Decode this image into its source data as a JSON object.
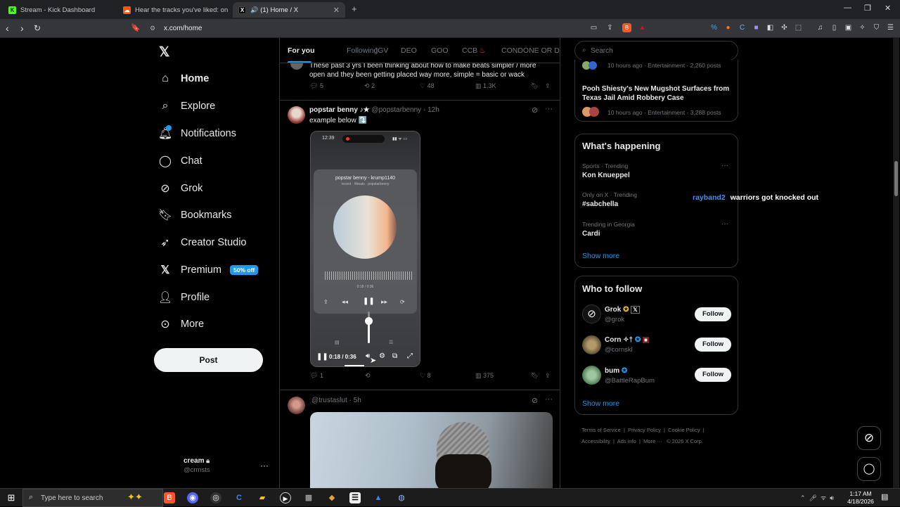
{
  "browser": {
    "tabs": [
      {
        "title": "Stream - Kick Dashboard",
        "icon": "kick-icon"
      },
      {
        "title": "Hear the tracks you've liked: on Sou",
        "icon": "soundcloud-icon"
      },
      {
        "title": "(1) Home / X",
        "icon": "x-icon"
      }
    ],
    "url": "x.com/home"
  },
  "nav": {
    "items": [
      {
        "label": "Home",
        "icon": "home-icon"
      },
      {
        "label": "Explore",
        "icon": "search-icon"
      },
      {
        "label": "Notifications",
        "icon": "bell-icon"
      },
      {
        "label": "Chat",
        "icon": "chat-icon"
      },
      {
        "label": "Grok",
        "icon": "grok-icon"
      },
      {
        "label": "Bookmarks",
        "icon": "bookmark-icon"
      },
      {
        "label": "Creator Studio",
        "icon": "rocket-icon"
      },
      {
        "label": "Premium",
        "icon": "x-logo-icon"
      },
      {
        "label": "Profile",
        "icon": "person-icon"
      },
      {
        "label": "More",
        "icon": "more-circle-icon"
      }
    ],
    "premium_badge": "50% off",
    "post_label": "Post",
    "account": {
      "name": "cream",
      "handle": "@crmsts"
    }
  },
  "feed": {
    "tabs": [
      "For you",
      "Following",
      "JGV",
      "DEO",
      "GOO",
      "CCB",
      "CONDONE OR DIE"
    ],
    "post1": {
      "text": "These past 3 yrs I been thinking about how to make beats simpler / more open and they been getting placed way more, simple = basic or wack",
      "replies": "5",
      "reposts": "2",
      "likes": "48",
      "views": "1.3K"
    },
    "post2": {
      "name": "popstar benny ♪★",
      "handle": "@popstarbenny",
      "time": "12h",
      "text": "example below ⤵️",
      "replies": "1",
      "reposts": "",
      "likes": "8",
      "views": "375",
      "video": {
        "time": "0:18 / 0:36",
        "phone_clock": "12:39",
        "track_title": "popstar benny - krump1140",
        "track_sub": "recent · #beats · popstarbenny",
        "track_time": "0:18 / 0:36",
        "volume": 0.72
      }
    },
    "post3": {
      "handle": "@trustaslut",
      "time": "5h"
    }
  },
  "right": {
    "search_placeholder": "Search",
    "top_trends": [
      {
        "meta": "10 hours ago · Entertainment · 2,260 posts"
      },
      {
        "title": "Pooh Shiesty's New Mugshot Surfaces from Texas Jail Amid Robbery Case",
        "meta": "10 hours ago · Entertainment · 3,288 posts"
      }
    ],
    "whats_happening": {
      "title": "What's happening",
      "trends": [
        {
          "meta": "Sports · Trending",
          "name": "Kon Knueppel"
        },
        {
          "meta": "Only on X · Trending",
          "name": "#sabchella"
        },
        {
          "meta": "Trending in Georgia",
          "name": "Cardi"
        }
      ],
      "show_more": "Show more"
    },
    "who_to_follow": {
      "title": "Who to follow",
      "users": [
        {
          "name": "Grok",
          "handle": "@grok"
        },
        {
          "name": "Corn ✧†",
          "handle": "@cornskl"
        },
        {
          "name": "bum",
          "handle": "@BattleRapBum"
        }
      ],
      "follow_label": "Follow",
      "show_more": "Show more"
    },
    "footer": [
      "Terms of Service",
      "Privacy Policy",
      "Cookie Policy",
      "Accessibility",
      "Ads info",
      "More ···",
      "© 2026 X Corp."
    ]
  },
  "overlay": {
    "user": "rayband2",
    "message": "warriors got knocked out"
  },
  "taskbar": {
    "search_placeholder": "Type here to search",
    "time": "1:17 AM",
    "date": "4/18/2026"
  },
  "colors": {
    "accent": "#1d9bf0",
    "kick": "#53fc18",
    "soundcloud": "#ff5500"
  }
}
